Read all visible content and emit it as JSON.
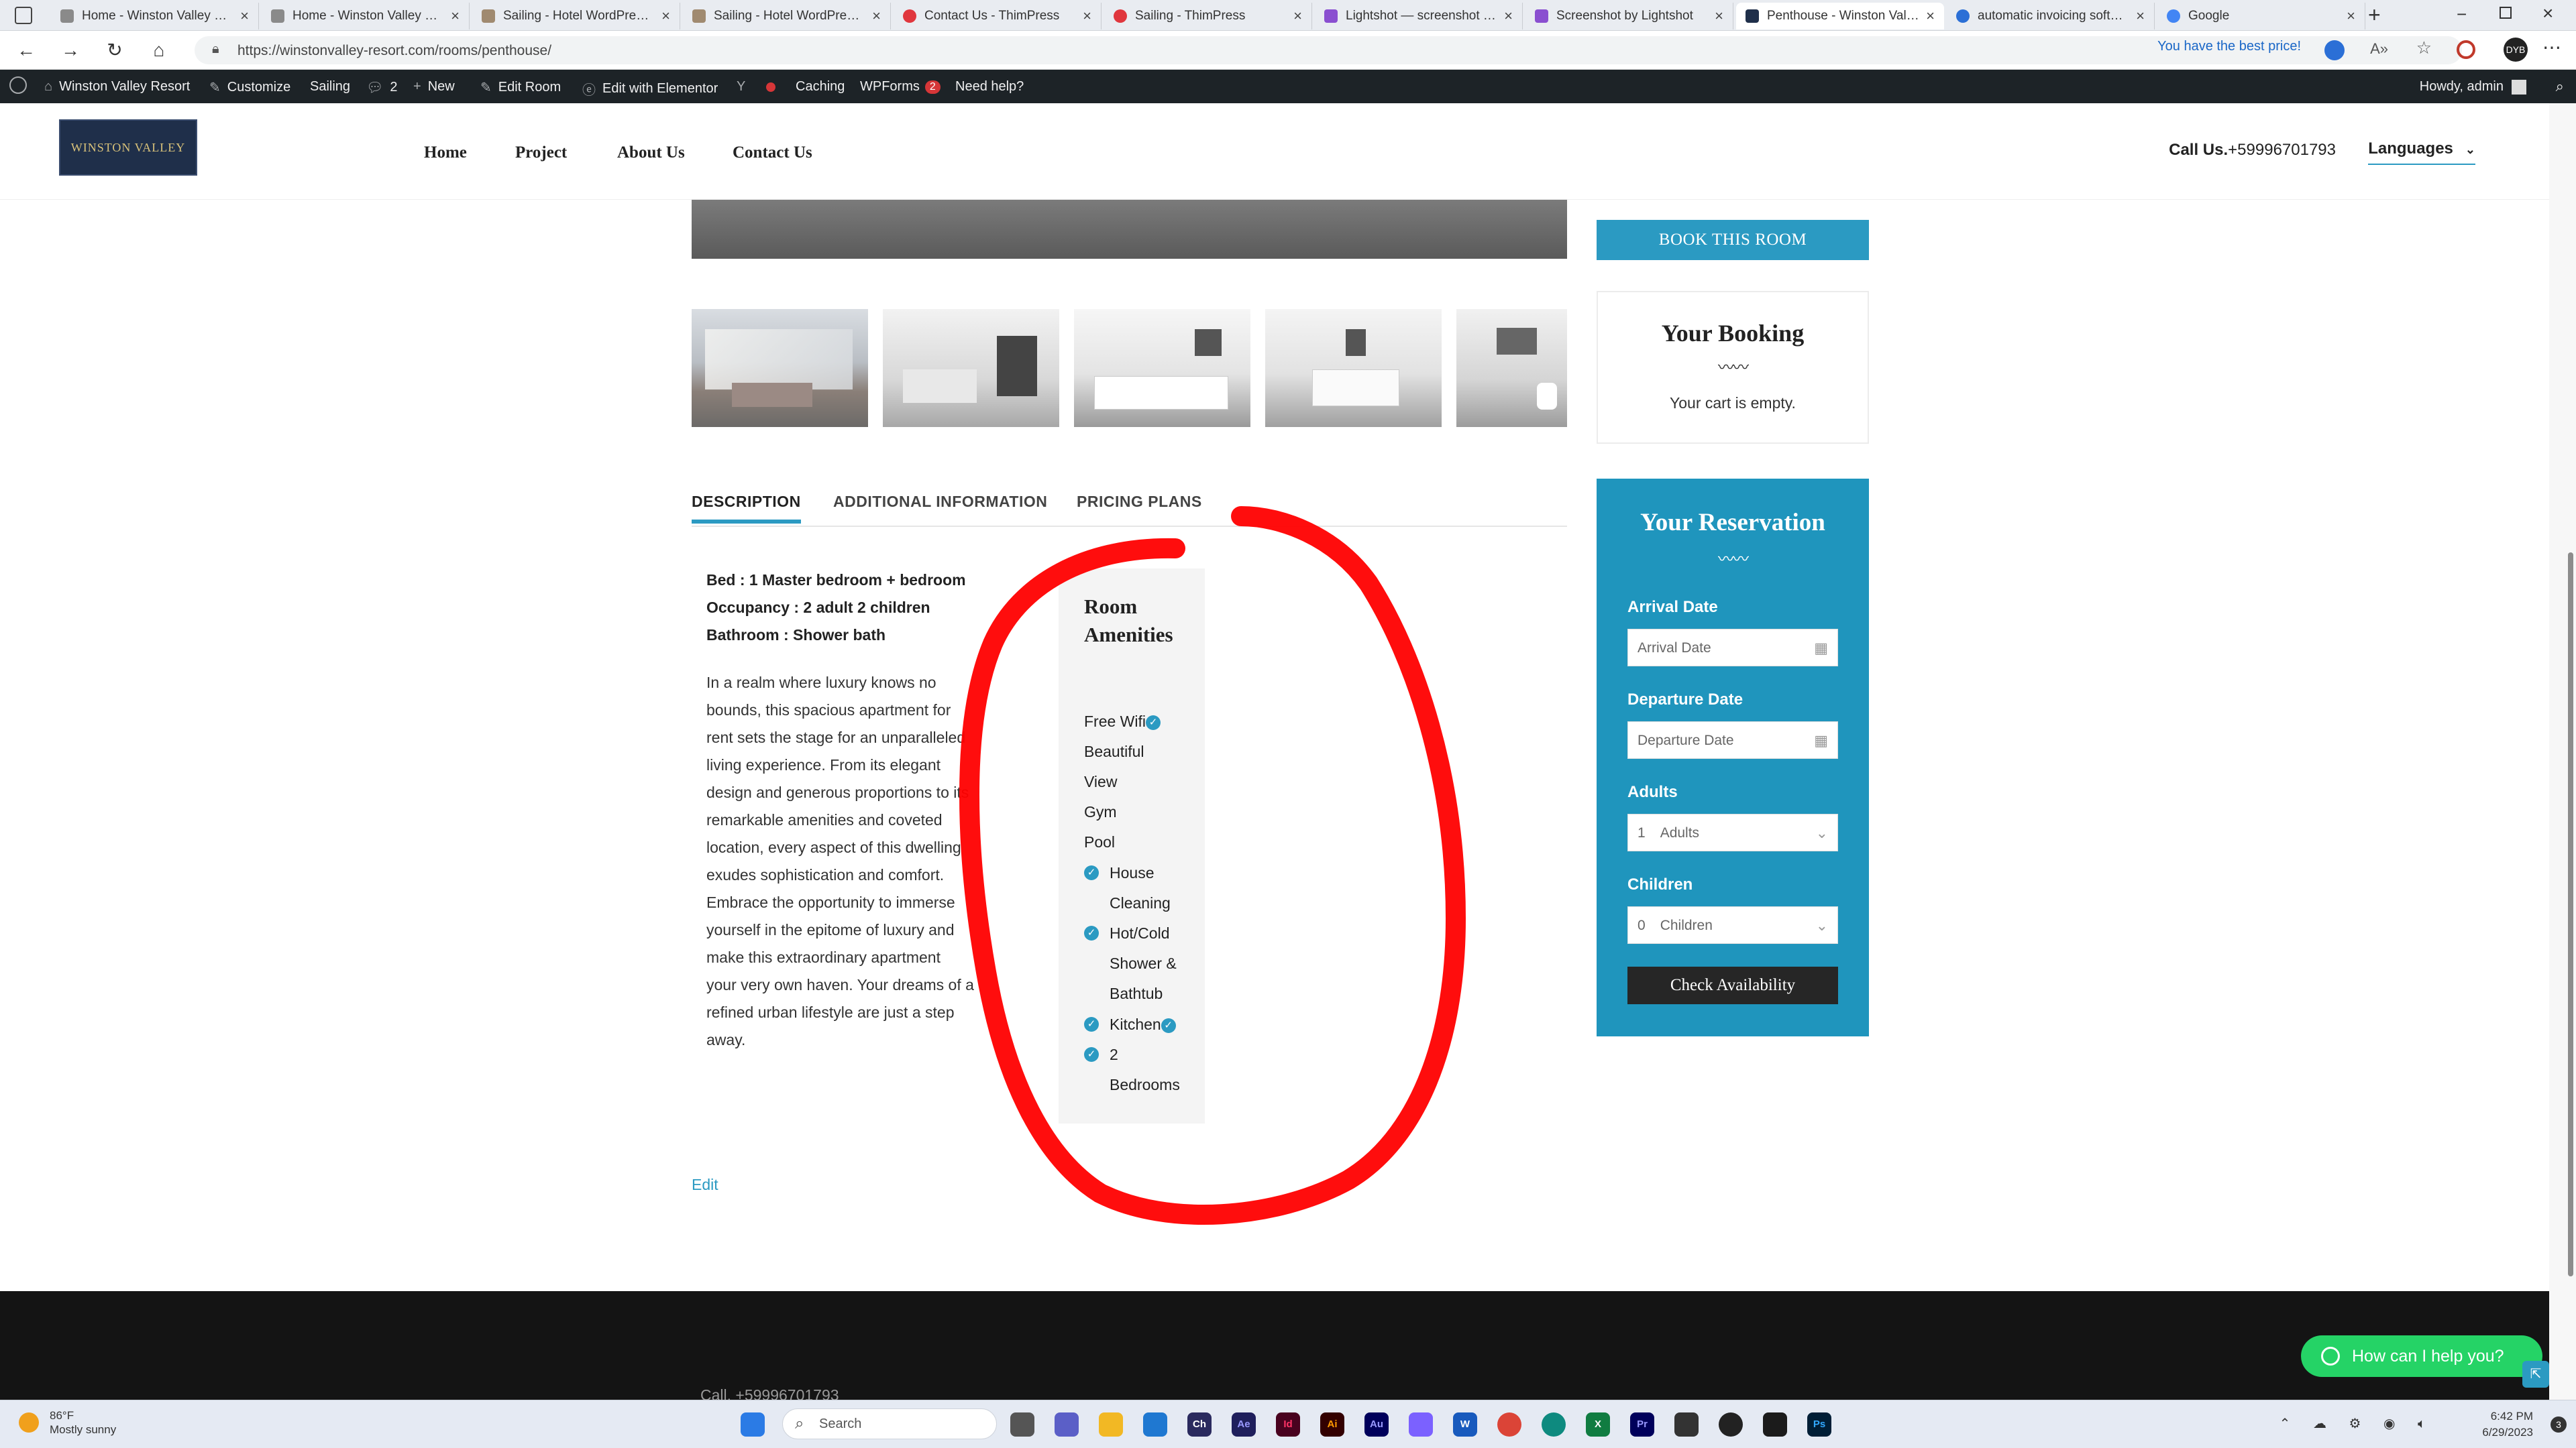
{
  "browser": {
    "tabs": [
      {
        "title": "Home - Winston Valley Resort",
        "color": "#8a8a8a"
      },
      {
        "title": "Home - Winston Valley Resort",
        "color": "#8a8a8a"
      },
      {
        "title": "Sailing - Hotel WordPress Theme",
        "color": "#a08a70"
      },
      {
        "title": "Sailing - Hotel WordPress Theme",
        "color": "#a08a70"
      },
      {
        "title": "Contact Us - ThimPress",
        "color": "#e0363d"
      },
      {
        "title": "Sailing - ThimPress",
        "color": "#e0363d"
      },
      {
        "title": "Lightshot — screenshot tool",
        "color": "#8a4fd0"
      },
      {
        "title": "Screenshot by Lightshot",
        "color": "#8a4fd0"
      },
      {
        "title": "Penthouse - Winston Valley",
        "color": "#1f2f4a"
      },
      {
        "title": "automatic invoicing software",
        "color": "#2b6fd6"
      },
      {
        "title": "Google",
        "color": "#4285f4"
      }
    ],
    "url": "https://winstonvalley-resort.com/rooms/penthouse/",
    "promo": "You have the best price!",
    "profile_initials": "DYB"
  },
  "wpbar": {
    "site": "Winston Valley Resort",
    "customize": "Customize",
    "theme": "Sailing",
    "comments": "2",
    "new": "New",
    "edit_room": "Edit Room",
    "elementor": "Edit with Elementor",
    "caching": "Caching",
    "wpforms": "WPForms",
    "wpforms_count": "2",
    "help": "Need help?",
    "howdy": "Howdy, admin"
  },
  "site": {
    "logo_text": "WINSTON VALLEY",
    "menu": [
      "Home",
      "Project",
      "About Us",
      "Contact Us"
    ],
    "call_label": "Call Us.",
    "call_number": "+59996701793",
    "languages": "Languages"
  },
  "room": {
    "tabs": [
      "DESCRIPTION",
      "ADDITIONAL INFORMATION",
      "PRICING PLANS"
    ],
    "specs": [
      "Bed : 1 Master bedroom + bedroom",
      "Occupancy : 2 adult 2 children",
      "Bathroom : Shower bath"
    ],
    "description": "In a realm where luxury knows no bounds, this spacious apartment for rent sets the stage for an unparalleled living experience. From its elegant design and generous proportions to its remarkable amenities and coveted location, every aspect of this dwelling exudes sophistication and comfort. Embrace the opportunity to immerse yourself in the epitome of luxury and make this extraordinary apartment your very own haven. Your dreams of a refined urban lifestyle are just a step away.",
    "amenities_title": "Room Amenities",
    "amenities": [
      "Free Wifi",
      "Beautiful View",
      "Gym",
      "Pool",
      "House Cleaning",
      "Hot/Cold Shower & Bathtub",
      "Kitchen",
      "2 Bedrooms"
    ],
    "edit": "Edit"
  },
  "sidebar": {
    "book_button": "BOOK THIS ROOM",
    "booking_title": "Your Booking",
    "cart_empty": "Your cart is empty.",
    "reservation_title": "Your Reservation",
    "arrival_label": "Arrival Date",
    "arrival_placeholder": "Arrival Date",
    "departure_label": "Departure Date",
    "departure_placeholder": "Departure Date",
    "adults_label": "Adults",
    "adults_value": "1",
    "adults_unit": "Adults",
    "children_label": "Children",
    "children_value": "0",
    "children_unit": "Children",
    "check_button": "Check Availability"
  },
  "footer": {
    "call": "Call. +59996701793",
    "whatsapp": "How can I help you?"
  },
  "taskbar": {
    "temp": "86°F",
    "weather": "Mostly sunny",
    "search": "Search",
    "time": "6:42 PM",
    "date": "6/29/2023",
    "notification_count": "3"
  },
  "colors": {
    "accent": "#2b9ac2",
    "annotation": "#ff0000",
    "wp_bar": "#1d2327",
    "footer": "#141414"
  }
}
